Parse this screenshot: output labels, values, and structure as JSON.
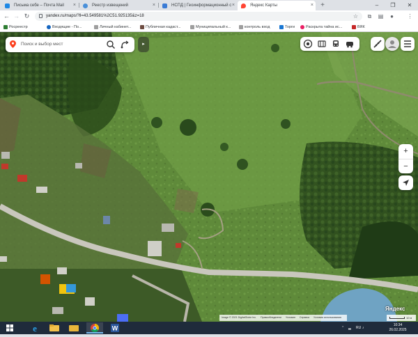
{
  "browser": {
    "tabs": [
      {
        "title": "Письма себе – Почта Mail",
        "color": "#1e88e5"
      },
      {
        "title": "Реестр извещений",
        "color": "#4a90d9"
      },
      {
        "title": "НСПД | Геоинформационный с",
        "color": "#3a7bd5"
      },
      {
        "title": "Яндекс Карты",
        "color": "#f43"
      }
    ],
    "active_tab": 3,
    "new_tab_symbol": "+",
    "url": "yandex.ru/maps/?ll=43.549581%2C51.925135&z=18",
    "bookmarks": [
      {
        "label": "Росреестр",
        "color": "#2e7d32"
      },
      {
        "label": "Входящие - По...",
        "color": "#1565c0"
      },
      {
        "label": "Личный кабинет...",
        "color": "#9e9e9e"
      },
      {
        "label": "Публичная кадаст...",
        "color": "#6d4c41"
      },
      {
        "label": "Муниципальный к...",
        "color": "#9e9e9e"
      },
      {
        "label": "контроль вход",
        "color": "#9e9e9e"
      },
      {
        "label": "Торги",
        "color": "#1976d2"
      },
      {
        "label": "Раскрыта тайна ис...",
        "color": "#e91e63"
      },
      {
        "label": "ВЯК",
        "color": "#c62828"
      }
    ]
  },
  "map": {
    "search_placeholder": "Поиск и выбор мест",
    "logo": "Яндекс",
    "attribution": [
      "Image © 2021 DigitalGlobe Inc.",
      "Правообладатели",
      "Условия",
      "Справка",
      "Условия использования"
    ],
    "scale_label": "10 м",
    "zoom_in": "+",
    "zoom_out": "−",
    "accent": "#fc3f1d"
  },
  "taskbar": {
    "apps": [
      "start",
      "ie",
      "explorer",
      "chrome",
      "word"
    ],
    "language": "RU",
    "time": "10:34",
    "date": "26.02.2025"
  }
}
